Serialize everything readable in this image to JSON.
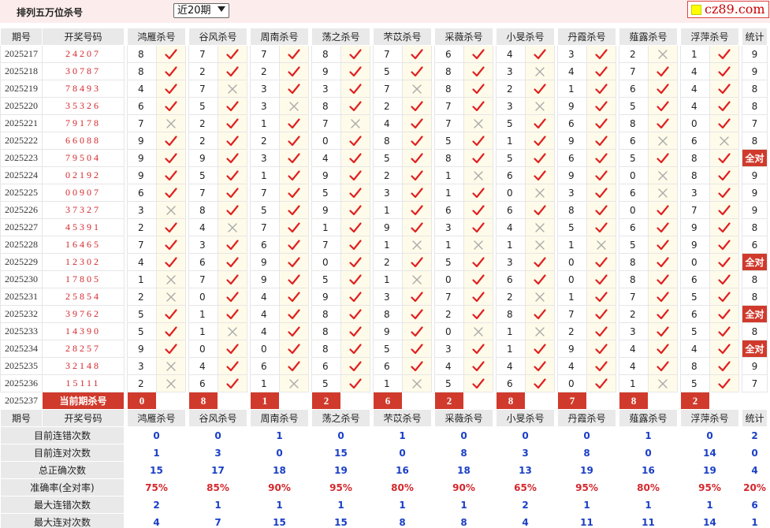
{
  "header": {
    "title": "排列五万位杀号",
    "period_select": "近20期",
    "logo": "cz89.com"
  },
  "table": {
    "col_issue": "期号",
    "col_win": "开奖号码",
    "col_stat": "统计",
    "experts": [
      "鸿雁杀号",
      "谷风杀号",
      "周南杀号",
      "荡之杀号",
      "芣苡杀号",
      "采薇杀号",
      "小旻杀号",
      "丹霞杀号",
      "薤露杀号",
      "浮萍杀号"
    ],
    "all_right_label": "全对",
    "rows": [
      {
        "issue": "2025217",
        "win": "24207",
        "picks": [
          8,
          7,
          7,
          8,
          7,
          6,
          4,
          3,
          2,
          1
        ],
        "hits": [
          1,
          1,
          1,
          1,
          1,
          1,
          1,
          1,
          0,
          1
        ],
        "stat": "9"
      },
      {
        "issue": "2025218",
        "win": "30787",
        "picks": [
          8,
          2,
          2,
          9,
          5,
          8,
          3,
          4,
          7,
          4
        ],
        "hits": [
          1,
          1,
          1,
          1,
          1,
          1,
          0,
          1,
          1,
          1
        ],
        "stat": "9"
      },
      {
        "issue": "2025219",
        "win": "78493",
        "picks": [
          4,
          7,
          3,
          3,
          7,
          8,
          2,
          1,
          6,
          4
        ],
        "hits": [
          1,
          0,
          1,
          1,
          0,
          1,
          1,
          1,
          1,
          1
        ],
        "stat": "8"
      },
      {
        "issue": "2025220",
        "win": "35326",
        "picks": [
          6,
          5,
          3,
          8,
          2,
          7,
          3,
          9,
          5,
          4
        ],
        "hits": [
          1,
          1,
          0,
          1,
          1,
          1,
          0,
          1,
          1,
          1
        ],
        "stat": "8"
      },
      {
        "issue": "2025221",
        "win": "79178",
        "picks": [
          7,
          2,
          1,
          7,
          4,
          7,
          5,
          6,
          8,
          0
        ],
        "hits": [
          0,
          1,
          1,
          0,
          1,
          0,
          1,
          1,
          1,
          1
        ],
        "stat": "7"
      },
      {
        "issue": "2025222",
        "win": "66088",
        "picks": [
          9,
          2,
          2,
          0,
          8,
          5,
          1,
          9,
          6,
          6
        ],
        "hits": [
          1,
          1,
          1,
          1,
          1,
          1,
          1,
          1,
          0,
          0
        ],
        "stat": "8"
      },
      {
        "issue": "2025223",
        "win": "79504",
        "picks": [
          9,
          9,
          3,
          4,
          5,
          8,
          5,
          6,
          5,
          8
        ],
        "hits": [
          1,
          1,
          1,
          1,
          1,
          1,
          1,
          1,
          1,
          1
        ],
        "stat": "全对"
      },
      {
        "issue": "2025224",
        "win": "02192",
        "picks": [
          9,
          5,
          1,
          9,
          2,
          1,
          6,
          9,
          0,
          8
        ],
        "hits": [
          1,
          1,
          1,
          1,
          1,
          0,
          1,
          1,
          0,
          1
        ],
        "stat": "9"
      },
      {
        "issue": "2025225",
        "win": "00907",
        "picks": [
          6,
          7,
          7,
          5,
          3,
          1,
          0,
          3,
          6,
          3
        ],
        "hits": [
          1,
          1,
          1,
          1,
          1,
          1,
          0,
          1,
          0,
          1
        ],
        "stat": "9"
      },
      {
        "issue": "2025226",
        "win": "37327",
        "picks": [
          3,
          8,
          5,
          9,
          1,
          6,
          6,
          8,
          0,
          7
        ],
        "hits": [
          0,
          1,
          1,
          1,
          1,
          1,
          1,
          1,
          1,
          1
        ],
        "stat": "9"
      },
      {
        "issue": "2025227",
        "win": "45391",
        "picks": [
          2,
          4,
          7,
          1,
          9,
          3,
          4,
          5,
          6,
          9
        ],
        "hits": [
          1,
          0,
          1,
          1,
          1,
          1,
          0,
          1,
          1,
          1
        ],
        "stat": "8"
      },
      {
        "issue": "2025228",
        "win": "16465",
        "picks": [
          7,
          3,
          6,
          7,
          1,
          1,
          1,
          1,
          5,
          9
        ],
        "hits": [
          1,
          1,
          1,
          1,
          0,
          0,
          0,
          0,
          1,
          1
        ],
        "stat": "6"
      },
      {
        "issue": "2025229",
        "win": "12302",
        "picks": [
          4,
          6,
          9,
          0,
          2,
          5,
          3,
          0,
          8,
          0
        ],
        "hits": [
          1,
          1,
          1,
          1,
          1,
          1,
          1,
          1,
          1,
          1
        ],
        "stat": "全对"
      },
      {
        "issue": "2025230",
        "win": "17805",
        "picks": [
          1,
          7,
          9,
          5,
          1,
          0,
          6,
          0,
          8,
          6
        ],
        "hits": [
          0,
          1,
          1,
          1,
          0,
          1,
          1,
          1,
          1,
          1
        ],
        "stat": "8"
      },
      {
        "issue": "2025231",
        "win": "25854",
        "picks": [
          2,
          0,
          4,
          9,
          3,
          7,
          2,
          1,
          7,
          5
        ],
        "hits": [
          0,
          1,
          1,
          1,
          1,
          1,
          0,
          1,
          1,
          1
        ],
        "stat": "8"
      },
      {
        "issue": "2025232",
        "win": "39762",
        "picks": [
          5,
          1,
          4,
          8,
          8,
          2,
          8,
          7,
          2,
          6
        ],
        "hits": [
          1,
          1,
          1,
          1,
          1,
          1,
          1,
          1,
          1,
          1
        ],
        "stat": "全对"
      },
      {
        "issue": "2025233",
        "win": "14390",
        "picks": [
          5,
          1,
          4,
          8,
          9,
          0,
          1,
          2,
          3,
          5
        ],
        "hits": [
          1,
          0,
          1,
          1,
          1,
          0,
          0,
          1,
          1,
          1
        ],
        "stat": "8"
      },
      {
        "issue": "2025234",
        "win": "28257",
        "picks": [
          9,
          0,
          0,
          8,
          5,
          3,
          1,
          9,
          4,
          4
        ],
        "hits": [
          1,
          1,
          1,
          1,
          1,
          1,
          1,
          1,
          1,
          1
        ],
        "stat": "全对"
      },
      {
        "issue": "2025235",
        "win": "32148",
        "picks": [
          3,
          4,
          6,
          6,
          6,
          4,
          4,
          4,
          4,
          8
        ],
        "hits": [
          0,
          1,
          1,
          1,
          1,
          1,
          1,
          1,
          1,
          1
        ],
        "stat": "9"
      },
      {
        "issue": "2025236",
        "win": "15111",
        "picks": [
          2,
          6,
          1,
          5,
          1,
          5,
          6,
          0,
          1,
          5
        ],
        "hits": [
          0,
          1,
          0,
          1,
          0,
          1,
          1,
          1,
          0,
          1
        ],
        "stat": "7"
      }
    ],
    "current": {
      "issue": "2025237",
      "label": "当前期杀号",
      "picks": [
        0,
        8,
        1,
        2,
        6,
        2,
        8,
        7,
        8,
        2
      ]
    },
    "summary": [
      {
        "label": "目前连错次数",
        "values": [
          "0",
          "0",
          "1",
          "0",
          "1",
          "0",
          "0",
          "0",
          "1",
          "0"
        ],
        "stat": "2",
        "red": false
      },
      {
        "label": "目前连对次数",
        "values": [
          "1",
          "3",
          "0",
          "15",
          "0",
          "8",
          "3",
          "8",
          "0",
          "14"
        ],
        "stat": "0",
        "red": false
      },
      {
        "label": "总正确次数",
        "values": [
          "15",
          "17",
          "18",
          "19",
          "16",
          "18",
          "13",
          "19",
          "16",
          "19"
        ],
        "stat": "4",
        "red": false
      },
      {
        "label": "准确率(全对率)",
        "values": [
          "75%",
          "85%",
          "90%",
          "95%",
          "80%",
          "90%",
          "65%",
          "95%",
          "80%",
          "95%"
        ],
        "stat": "20%",
        "red": true
      },
      {
        "label": "最大连错次数",
        "values": [
          "2",
          "1",
          "1",
          "1",
          "1",
          "1",
          "2",
          "1",
          "1",
          "1"
        ],
        "stat": "6",
        "red": false
      },
      {
        "label": "最大连对次数",
        "values": [
          "4",
          "7",
          "15",
          "15",
          "8",
          "8",
          "4",
          "11",
          "11",
          "14"
        ],
        "stat": "1",
        "red": false
      }
    ]
  },
  "colors": {
    "accent_red": "#d03a2c",
    "check_red": "#e02020",
    "cross_gray": "#aaaaaa",
    "value_blue": "#1a3fc6"
  }
}
